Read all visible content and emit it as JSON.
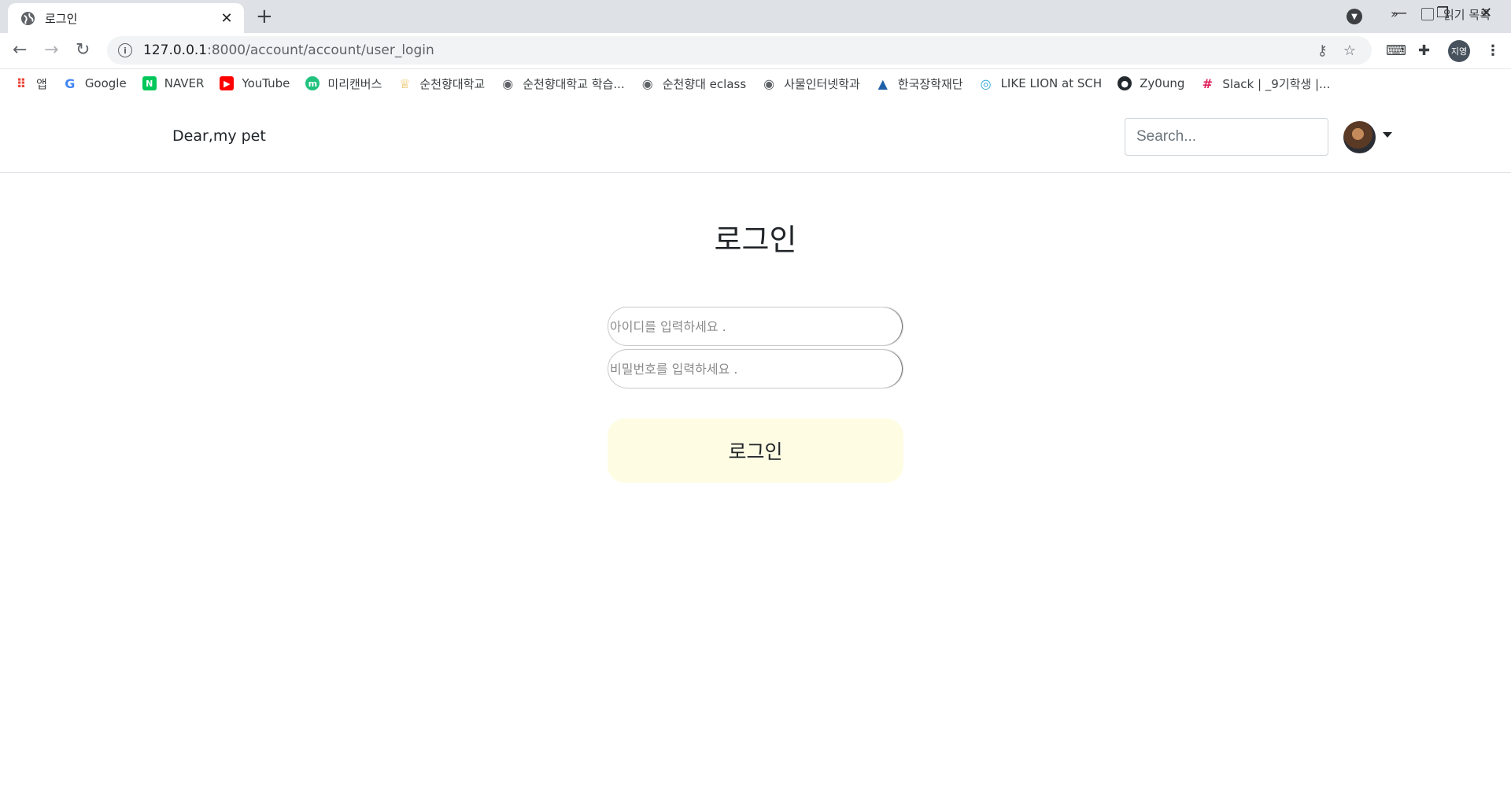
{
  "browser": {
    "tab": {
      "title": "로그인",
      "close_icon": "close-icon"
    },
    "new_tab_label": "+",
    "window_controls": {
      "minimize": "—",
      "restore": "❐",
      "close": "✕"
    },
    "url": {
      "host": "127.0.0.1",
      "path": ":8000/account/account/user_login"
    },
    "profile_initials": "지영",
    "bookmarks": [
      {
        "label": "앱",
        "icon": "apps-grid-icon",
        "color": "#ea4335"
      },
      {
        "label": "Google",
        "icon": "google-icon",
        "color": "#4285f4"
      },
      {
        "label": "NAVER",
        "icon": "naver-icon",
        "color": "#03c75a"
      },
      {
        "label": "YouTube",
        "icon": "youtube-icon",
        "color": "#ff0000"
      },
      {
        "label": "미리캔버스",
        "icon": "miricanvas-icon",
        "color": "#21c27d"
      },
      {
        "label": "순천향대학교",
        "icon": "sch-logo-icon",
        "color": "#e8b84a"
      },
      {
        "label": "순천향대학교 학습...",
        "icon": "globe-icon",
        "color": "#5f6368"
      },
      {
        "label": "순천향대 eclass",
        "icon": "globe-icon",
        "color": "#5f6368"
      },
      {
        "label": "사물인터넷학과",
        "icon": "globe-icon",
        "color": "#5f6368"
      },
      {
        "label": "한국장학재단",
        "icon": "graduation-cap-icon",
        "color": "#1f5fa8"
      },
      {
        "label": "LIKE LION at SCH",
        "icon": "likelion-icon",
        "color": "#2ea7d8"
      },
      {
        "label": "Zy0ung",
        "icon": "github-icon",
        "color": "#24292e"
      },
      {
        "label": "Slack | _9기학생 |...",
        "icon": "slack-icon",
        "color": "#e01e5a"
      }
    ],
    "bookmarks_overflow": "»",
    "reading_list": "읽기 목록"
  },
  "site": {
    "brand": "Dear,my pet",
    "search_placeholder": "Search..."
  },
  "login": {
    "title": "로그인",
    "id_placeholder": "아이디를 입력하세요 .",
    "pw_placeholder": "비밀번호를 입력하세요 .",
    "button_label": "로그인",
    "button_color": "#fefde4"
  }
}
